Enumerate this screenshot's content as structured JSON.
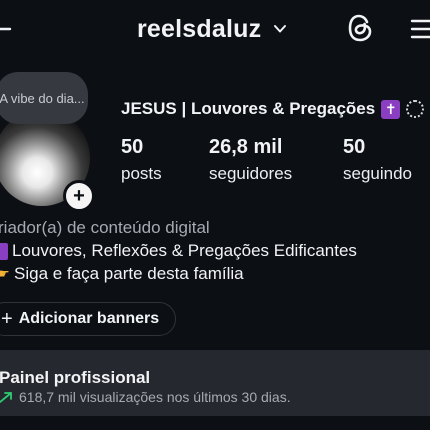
{
  "header": {
    "username": "reelsdaluz"
  },
  "note": {
    "text": "A vibe do dia..."
  },
  "profile": {
    "name": "JESUS | Louvores & Pregações",
    "stats": [
      {
        "value": "50",
        "label": "posts"
      },
      {
        "value": "26,8 mil",
        "label": "seguidores"
      },
      {
        "value": "50",
        "label": "seguindo"
      }
    ]
  },
  "bio": {
    "category": "riador(a) de conteúdo digital",
    "line1": "Louvores, Reflexões & Pregações Edificantes",
    "line2": "Siga e faça parte desta família"
  },
  "actions": {
    "add_banners": "Adicionar banners"
  },
  "dashboard": {
    "title": "Painel profissional",
    "subtitle": "618,7 mil visualizações nos últimos 30 dias."
  },
  "colors": {
    "background": "#0c0f14",
    "dashboard_bg": "#25282e",
    "accent_purple": "#8a3fc2",
    "trend_green": "#2ecc71"
  },
  "icons": [
    "back-arrow-icon",
    "chevron-down-icon",
    "threads-icon",
    "menu-icon",
    "plus-icon",
    "cross-icon",
    "trend-up-icon"
  ]
}
